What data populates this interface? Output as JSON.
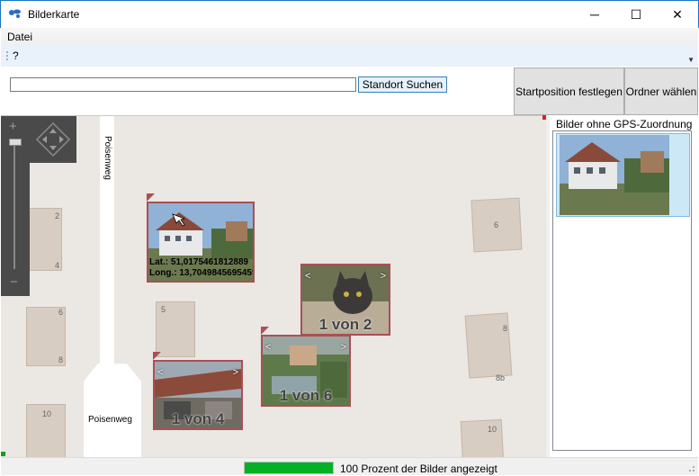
{
  "window": {
    "title": "Bilderkarte",
    "controls": {
      "minimize": "─",
      "maximize": "☐",
      "close": "✕"
    }
  },
  "menu": {
    "items": [
      "Datei"
    ]
  },
  "toolstrip": {
    "help": "?"
  },
  "search": {
    "value": "",
    "button": "Standort Suchen",
    "set_start": "Startposition festlegen",
    "choose_folder": "Ordner wählen"
  },
  "map": {
    "street_vertical": "Poisenweg",
    "street_bottom": "Poisenweg",
    "house_numbers": [
      "2",
      "4",
      "6",
      "8",
      "10",
      "5",
      "6",
      "8",
      "8b",
      "10"
    ],
    "markers": [
      {
        "type": "single",
        "lat": "Lat.: 51,0175461812889",
        "long": "Long.: 13,7049845695459"
      },
      {
        "type": "group",
        "counter": "1 von 2"
      },
      {
        "type": "group",
        "counter": "1 von 6"
      },
      {
        "type": "group",
        "counter": "1 von 4"
      }
    ],
    "nav": {
      "prev": "<",
      "next": ">"
    }
  },
  "side": {
    "title": "Bilder ohne GPS-Zuordnung"
  },
  "status": {
    "progress_percent": 100,
    "text": "100 Prozent der Bilder angezeigt"
  },
  "colors": {
    "marker_border": "#a94f55",
    "progress": "#06b025",
    "selection": "#cce8f7",
    "map_bg": "#ebe7e2"
  }
}
